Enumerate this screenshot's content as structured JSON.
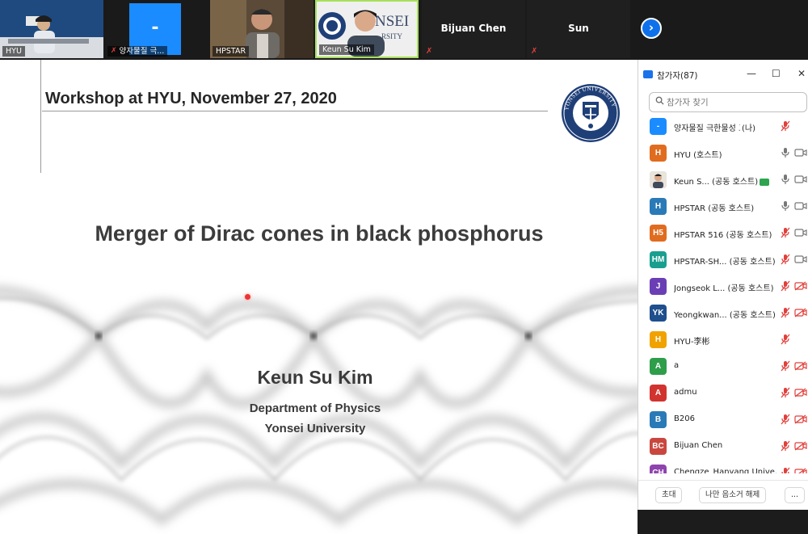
{
  "video_strip": {
    "tiles": [
      {
        "name": "HYU",
        "muted": false
      },
      {
        "name": "양자물질 극...",
        "muted": true,
        "placeholder": "-"
      },
      {
        "name": "HPSTAR",
        "muted": false
      },
      {
        "name": "Keun Su Kim",
        "muted": false
      },
      {
        "name": "Bijuan Chen",
        "muted": true
      },
      {
        "name": "Sun",
        "muted": true
      }
    ],
    "next_icon": "chevron-right-icon"
  },
  "slide": {
    "workshop": "Workshop at HYU, November 27, 2020",
    "title": "Merger of Dirac cones in black phosphorus",
    "speaker": "Keun Su Kim",
    "department": "Department of Physics",
    "university": "Yonsei University",
    "seal_text": "YONSEI UNIVERSITY"
  },
  "participants_panel": {
    "title": "참가자(87)",
    "search_placeholder": "참가자 찾기",
    "items": [
      {
        "avatar": "-",
        "color": "#1a8cff",
        "name": "양자물질 극한물성 교육...",
        "suffix": "(나)",
        "mic": "muted",
        "cam": "none"
      },
      {
        "avatar": "H",
        "color": "#e06c1f",
        "name": "HYU (호스트)",
        "mic": "on",
        "cam": "on"
      },
      {
        "avatar": "photo",
        "color": "#c9b79c",
        "name": "Keun S... (공동 호스트)",
        "badge": true,
        "mic": "on",
        "cam": "on"
      },
      {
        "avatar": "H",
        "color": "#2a7ab8",
        "name": "HPSTAR (공동 호스트)",
        "mic": "on",
        "cam": "on"
      },
      {
        "avatar": "H5",
        "color": "#e06c1f",
        "name": "HPSTAR 516 (공동 호스트)",
        "mic": "muted",
        "cam": "on"
      },
      {
        "avatar": "HM",
        "color": "#1a9e8f",
        "name": "HPSTAR-SH... (공동 호스트)",
        "mic": "muted",
        "cam": "on"
      },
      {
        "avatar": "J",
        "color": "#6a3fb5",
        "name": "Jongseok L... (공동 호스트)",
        "mic": "muted",
        "cam": "off"
      },
      {
        "avatar": "YK",
        "color": "#1f4f8c",
        "name": "Yeongkwan... (공동 호스트)",
        "mic": "muted",
        "cam": "off"
      },
      {
        "avatar": "H",
        "color": "#f0a300",
        "name": "HYU-李彬",
        "mic": "muted",
        "cam": "none"
      },
      {
        "avatar": "A",
        "color": "#2e9e4a",
        "name": "a",
        "mic": "muted",
        "cam": "off"
      },
      {
        "avatar": "A",
        "color": "#d1342f",
        "name": "admu",
        "mic": "muted",
        "cam": "off"
      },
      {
        "avatar": "B",
        "color": "#2a7ab8",
        "name": "B206",
        "mic": "muted",
        "cam": "off"
      },
      {
        "avatar": "BC",
        "color": "#c9473e",
        "name": "Bijuan Chen",
        "mic": "muted",
        "cam": "off"
      },
      {
        "avatar": "CH",
        "color": "#8e44ad",
        "name": "Chengze_Hanyang Unive...",
        "mic": "muted",
        "cam": "off"
      }
    ],
    "footer": {
      "invite": "초대",
      "unmute_me": "나만 음소거 해제",
      "more": "..."
    }
  },
  "colors": {
    "muted_red": "#e0403b",
    "zoom_blue": "#0e71eb",
    "slide_text": "#3a3a3a"
  }
}
